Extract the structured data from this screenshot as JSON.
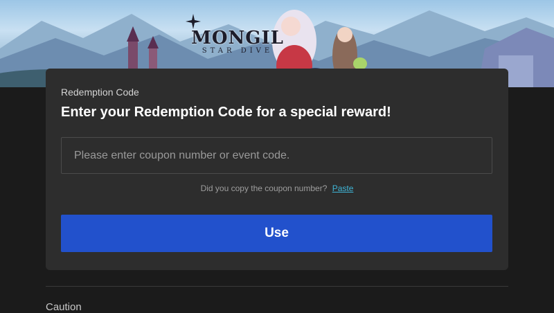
{
  "banner": {
    "logo_title": "MONGIL",
    "logo_subtitle": "STAR DIVE"
  },
  "redeem": {
    "label": "Redemption Code",
    "heading": "Enter your Redemption Code for a special reward!",
    "input_placeholder": "Please enter coupon number or event code.",
    "input_value": "",
    "copy_prompt": "Did you copy the coupon number?",
    "paste_label": "Paste",
    "use_label": "Use"
  },
  "caution": {
    "title": "Caution"
  },
  "colors": {
    "page_bg": "#1b1b1b",
    "card_bg": "#2d2d2d",
    "accent_button": "#2251cc",
    "link": "#3fb6d8"
  }
}
